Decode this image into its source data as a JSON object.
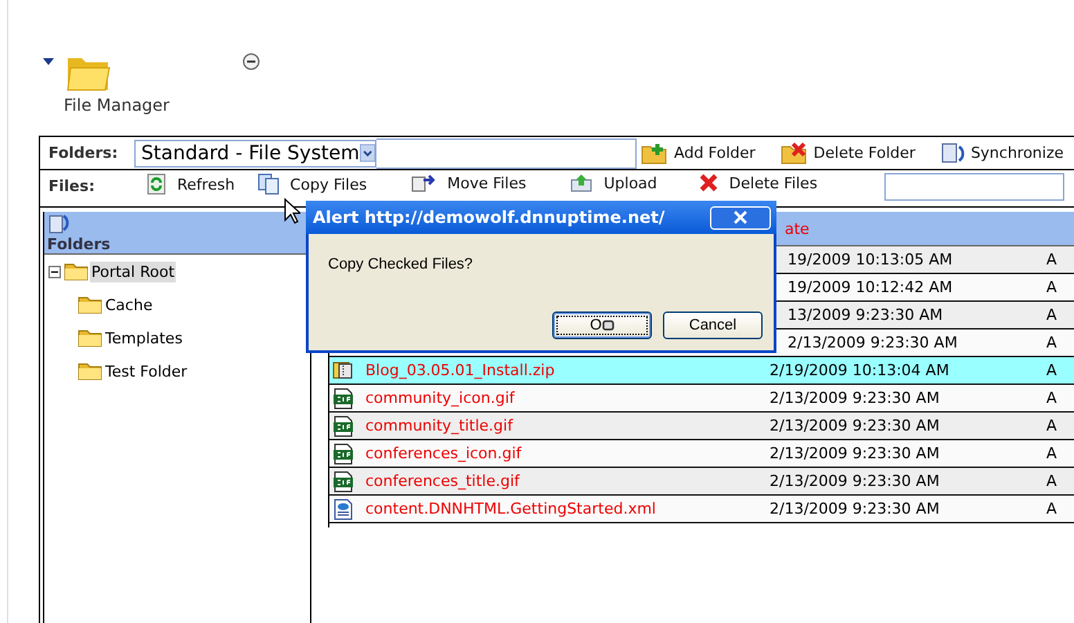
{
  "module": {
    "title": "File Manager"
  },
  "folders_bar": {
    "label": "Folders:",
    "select_value": "Standard - File System",
    "actions": [
      {
        "kind": "add",
        "label": "Add Folder"
      },
      {
        "kind": "delete",
        "label": "Delete Folder"
      },
      {
        "kind": "sync",
        "label": "Synchronize"
      }
    ]
  },
  "files_bar": {
    "label": "Files:",
    "actions": [
      {
        "kind": "refresh",
        "label": "Refresh"
      },
      {
        "kind": "copy",
        "label": "Copy Files"
      },
      {
        "kind": "move",
        "label": "Move Files"
      },
      {
        "kind": "upload",
        "label": "Upload"
      },
      {
        "kind": "delete",
        "label": "Delete Files"
      }
    ]
  },
  "tree": {
    "title": "Folders",
    "items": [
      {
        "label": "Portal Root",
        "selected": true,
        "expanded": true,
        "children": [
          {
            "label": "Cache",
            "selected": false
          },
          {
            "label": "Templates",
            "selected": false
          },
          {
            "label": "Test Folder",
            "selected": false
          }
        ]
      }
    ]
  },
  "table": {
    "date_header": "ate",
    "rows": [
      {
        "date": "19/2009 10:13:05 AM",
        "attr": "A",
        "selected": false
      },
      {
        "date": "19/2009 10:12:42 AM",
        "attr": "A",
        "selected": false
      },
      {
        "date": "13/2009 9:23:30 AM",
        "attr": "A",
        "selected": false
      },
      {
        "date": "2/13/2009 9:23:30 AM",
        "attr": "A",
        "selected": false
      },
      {
        "kind": "zip",
        "name": "Blog_03.05.01_Install.zip",
        "date": "2/19/2009 10:13:04 AM",
        "attr": "A",
        "selected": true
      },
      {
        "kind": "gif",
        "name": "community_icon.gif",
        "date": "2/13/2009 9:23:30 AM",
        "attr": "A",
        "selected": false
      },
      {
        "kind": "gif",
        "name": "community_title.gif",
        "date": "2/13/2009 9:23:30 AM",
        "attr": "A",
        "selected": false
      },
      {
        "kind": "gif",
        "name": "conferences_icon.gif",
        "date": "2/13/2009 9:23:30 AM",
        "attr": "A",
        "selected": false
      },
      {
        "kind": "gif",
        "name": "conferences_title.gif",
        "date": "2/13/2009 9:23:30 AM",
        "attr": "A",
        "selected": false
      },
      {
        "kind": "xml",
        "name": "content.DNNHTML.GettingStarted.xml",
        "date": "2/13/2009 9:23:30 AM",
        "attr": "A",
        "selected": false
      }
    ]
  },
  "dialog": {
    "title": "Alert http://demowolf.dnnuptime.net/",
    "message": "Copy Checked Files?",
    "buttons": [
      {
        "label": "O",
        "default": true
      },
      {
        "label": "Cancel",
        "default": false
      }
    ]
  }
}
